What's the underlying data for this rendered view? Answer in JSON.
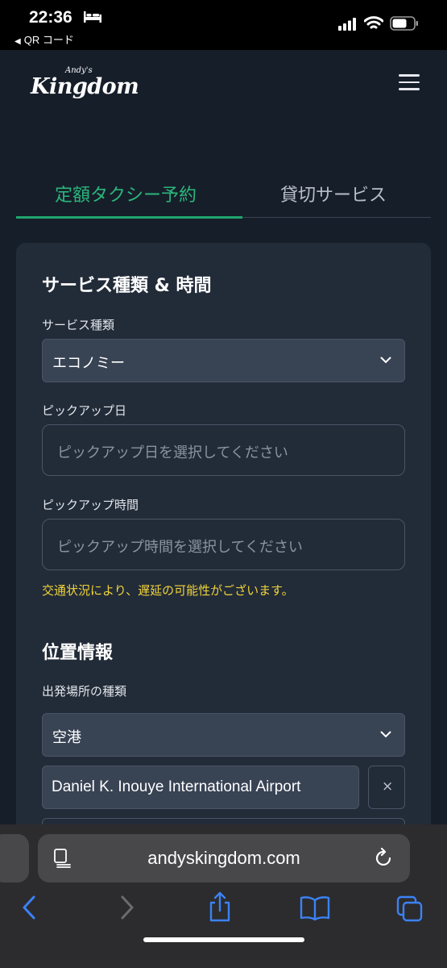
{
  "status_bar": {
    "time": "22:36",
    "back_app": "QR コード"
  },
  "header": {
    "logo_small": "Andy's",
    "logo_big": "Kingdom"
  },
  "tabs": [
    {
      "label": "定額タクシー予約",
      "active": true
    },
    {
      "label": "貸切サービス",
      "active": false
    }
  ],
  "section_service": {
    "title": "サービス種類 & 時間",
    "service_type_label": "サービス種類",
    "service_type_value": "エコノミー",
    "pickup_date_label": "ピックアップ日",
    "pickup_date_placeholder": "ピックアップ日を選択してください",
    "pickup_time_label": "ピックアップ時間",
    "pickup_time_placeholder": "ピックアップ時間を選択してください",
    "notice": "交通状況により、遅延の可能性がございます。"
  },
  "section_location": {
    "title": "位置情報",
    "departure_type_label": "出発場所の種類",
    "departure_type_value": "空港",
    "airport_value": "Daniel K. Inouye International Airport",
    "clear_symbol": "×"
  },
  "browser": {
    "url": "andyskingdom.com"
  },
  "colors": {
    "accent": "#2bb67a",
    "background": "#161e2a",
    "card": "#222b38",
    "notice": "#f0d43a",
    "browser_icon": "#3b82f6"
  }
}
